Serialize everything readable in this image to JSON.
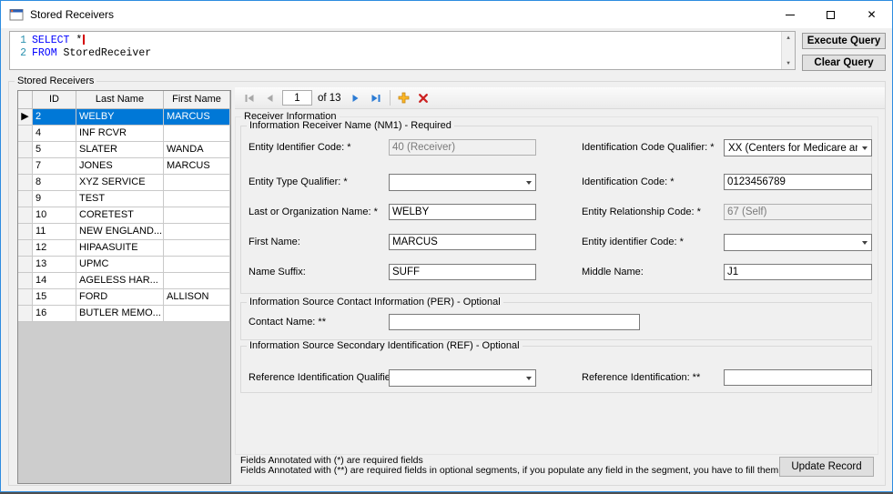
{
  "window": {
    "title": "Stored Receivers"
  },
  "colors": {
    "selection_blue": "#0078D7",
    "sql_keyword_blue": "#0000FF",
    "window_border_blue": "#2D8CE0"
  },
  "query": {
    "lines": [
      {
        "number": "1",
        "keyword": "SELECT",
        "rest": " *"
      },
      {
        "number": "2",
        "keyword": "FROM",
        "rest": " StoredReceiver"
      }
    ],
    "execute_label": "Execute Query",
    "clear_label": "Clear Query"
  },
  "stored_receivers": {
    "group_label": "Stored Receivers",
    "grid": {
      "columns": [
        "ID",
        "Last Name",
        "First Name"
      ],
      "rows": [
        {
          "id": "2",
          "last_name": "WELBY",
          "first_name": "MARCUS",
          "selected": true
        },
        {
          "id": "4",
          "last_name": "INF RCVR",
          "first_name": "",
          "selected": false
        },
        {
          "id": "5",
          "last_name": "SLATER",
          "first_name": "WANDA",
          "selected": false
        },
        {
          "id": "7",
          "last_name": "JONES",
          "first_name": "MARCUS",
          "selected": false
        },
        {
          "id": "8",
          "last_name": "XYZ SERVICE",
          "first_name": "",
          "selected": false
        },
        {
          "id": "9",
          "last_name": "TEST",
          "first_name": "",
          "selected": false
        },
        {
          "id": "10",
          "last_name": "CORETEST",
          "first_name": "",
          "selected": false
        },
        {
          "id": "11",
          "last_name": "NEW ENGLAND...",
          "first_name": "",
          "selected": false
        },
        {
          "id": "12",
          "last_name": "HIPAASUITE",
          "first_name": "",
          "selected": false
        },
        {
          "id": "13",
          "last_name": "UPMC",
          "first_name": "",
          "selected": false
        },
        {
          "id": "14",
          "last_name": "AGELESS HAR...",
          "first_name": "",
          "selected": false
        },
        {
          "id": "15",
          "last_name": "FORD",
          "first_name": "ALLISON",
          "selected": false
        },
        {
          "id": "16",
          "last_name": "BUTLER MEMO...",
          "first_name": "",
          "selected": false
        }
      ]
    }
  },
  "navigator": {
    "position": "1",
    "of_label": "of 13"
  },
  "receiver_info": {
    "group_label": "Receiver Information",
    "nm1": {
      "group_label": "Information Receiver Name (NM1) - Required",
      "entity_identifier_code": {
        "label": "Entity Identifier Code: *",
        "value": "40 (Receiver)"
      },
      "identification_code_qualifier": {
        "label": "Identification Code Qualifier: *",
        "value": "XX (Centers for Medicare and Medicaid"
      },
      "entity_type_qualifier": {
        "label": "Entity Type Qualifier: *",
        "value": ""
      },
      "identification_code": {
        "label": "Identification Code: *",
        "value": "0123456789"
      },
      "last_or_organization_name": {
        "label": "Last or Organization Name: *",
        "value": "WELBY"
      },
      "entity_relationship_code": {
        "label": "Entity Relationship Code: *",
        "value": "67 (Self)"
      },
      "first_name": {
        "label": "First Name:",
        "value": "MARCUS"
      },
      "entity_identifier_code_2": {
        "label": "Entity identifier Code: *",
        "value": ""
      },
      "name_suffix": {
        "label": "Name Suffix:",
        "value": "SUFF"
      },
      "middle_name": {
        "label": "Middle Name:",
        "value": "J1"
      }
    },
    "per": {
      "group_label": "Information Source Contact Information (PER) - Optional",
      "contact_name": {
        "label": "Contact Name: **",
        "value": ""
      }
    },
    "ref": {
      "group_label": "Information Source Secondary Identification (REF) - Optional",
      "reference_identification_qualifier": {
        "label": "Reference Identification Qualifier: **",
        "value": ""
      },
      "reference_identification": {
        "label": "Reference Identification: **",
        "value": ""
      }
    }
  },
  "footer": {
    "note1": "Fields Annotated with (*) are required fields",
    "note2": "Fields Annotated with (**) are required fields in optional segments, if you populate any field in the segment, you have to fill them too.",
    "update_label": "Update Record"
  }
}
